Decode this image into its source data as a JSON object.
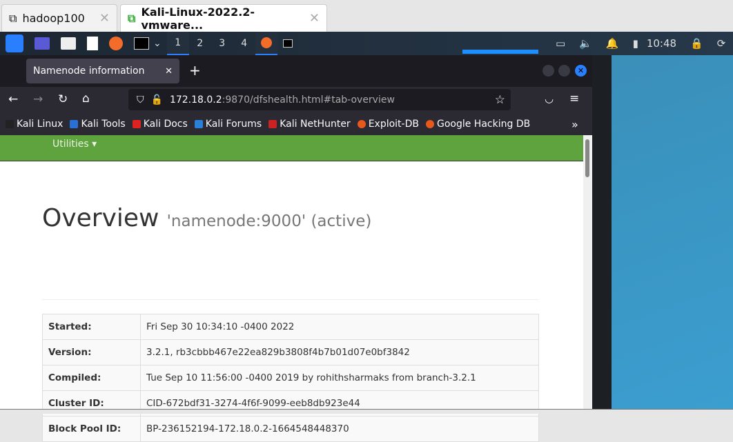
{
  "host_tabs": [
    {
      "label": "hadoop100"
    },
    {
      "label": "Kali-Linux-2022.2-vmware..."
    }
  ],
  "panel": {
    "workspaces": [
      "1",
      "2",
      "3",
      "4"
    ],
    "clock": "10:48"
  },
  "firefox": {
    "tab_title": "Namenode information",
    "url_host": "172.18.0.2",
    "url_rest": ":9870/dfshealth.html#tab-overview",
    "bookmarks": [
      {
        "label": "Kali Linux",
        "color": "#222222"
      },
      {
        "label": "Kali Tools",
        "color": "#2a6fd6"
      },
      {
        "label": "Kali Docs",
        "color": "#d22"
      },
      {
        "label": "Kali Forums",
        "color": "#2a7fd6"
      },
      {
        "label": "Kali NetHunter",
        "color": "#c22"
      },
      {
        "label": "Exploit-DB",
        "color": "#e8581c"
      },
      {
        "label": "Google Hacking DB",
        "color": "#e8581c"
      }
    ]
  },
  "page": {
    "nav_utilities": "Utilities",
    "title": "Overview",
    "subtitle": "'namenode:9000' (active)",
    "rows": [
      {
        "k": "Started:",
        "v": "Fri Sep 30 10:34:10 -0400 2022"
      },
      {
        "k": "Version:",
        "v": "3.2.1, rb3cbbb467e22ea829b3808f4b7b01d07e0bf3842"
      },
      {
        "k": "Compiled:",
        "v": "Tue Sep 10 11:56:00 -0400 2019 by rohithsharmaks from branch-3.2.1"
      },
      {
        "k": "Cluster ID:",
        "v": "CID-672bdf31-3274-4f6f-9099-eeb8db923e44"
      },
      {
        "k": "Block Pool ID:",
        "v": "BP-236152194-172.18.0.2-1664548448370"
      }
    ]
  }
}
